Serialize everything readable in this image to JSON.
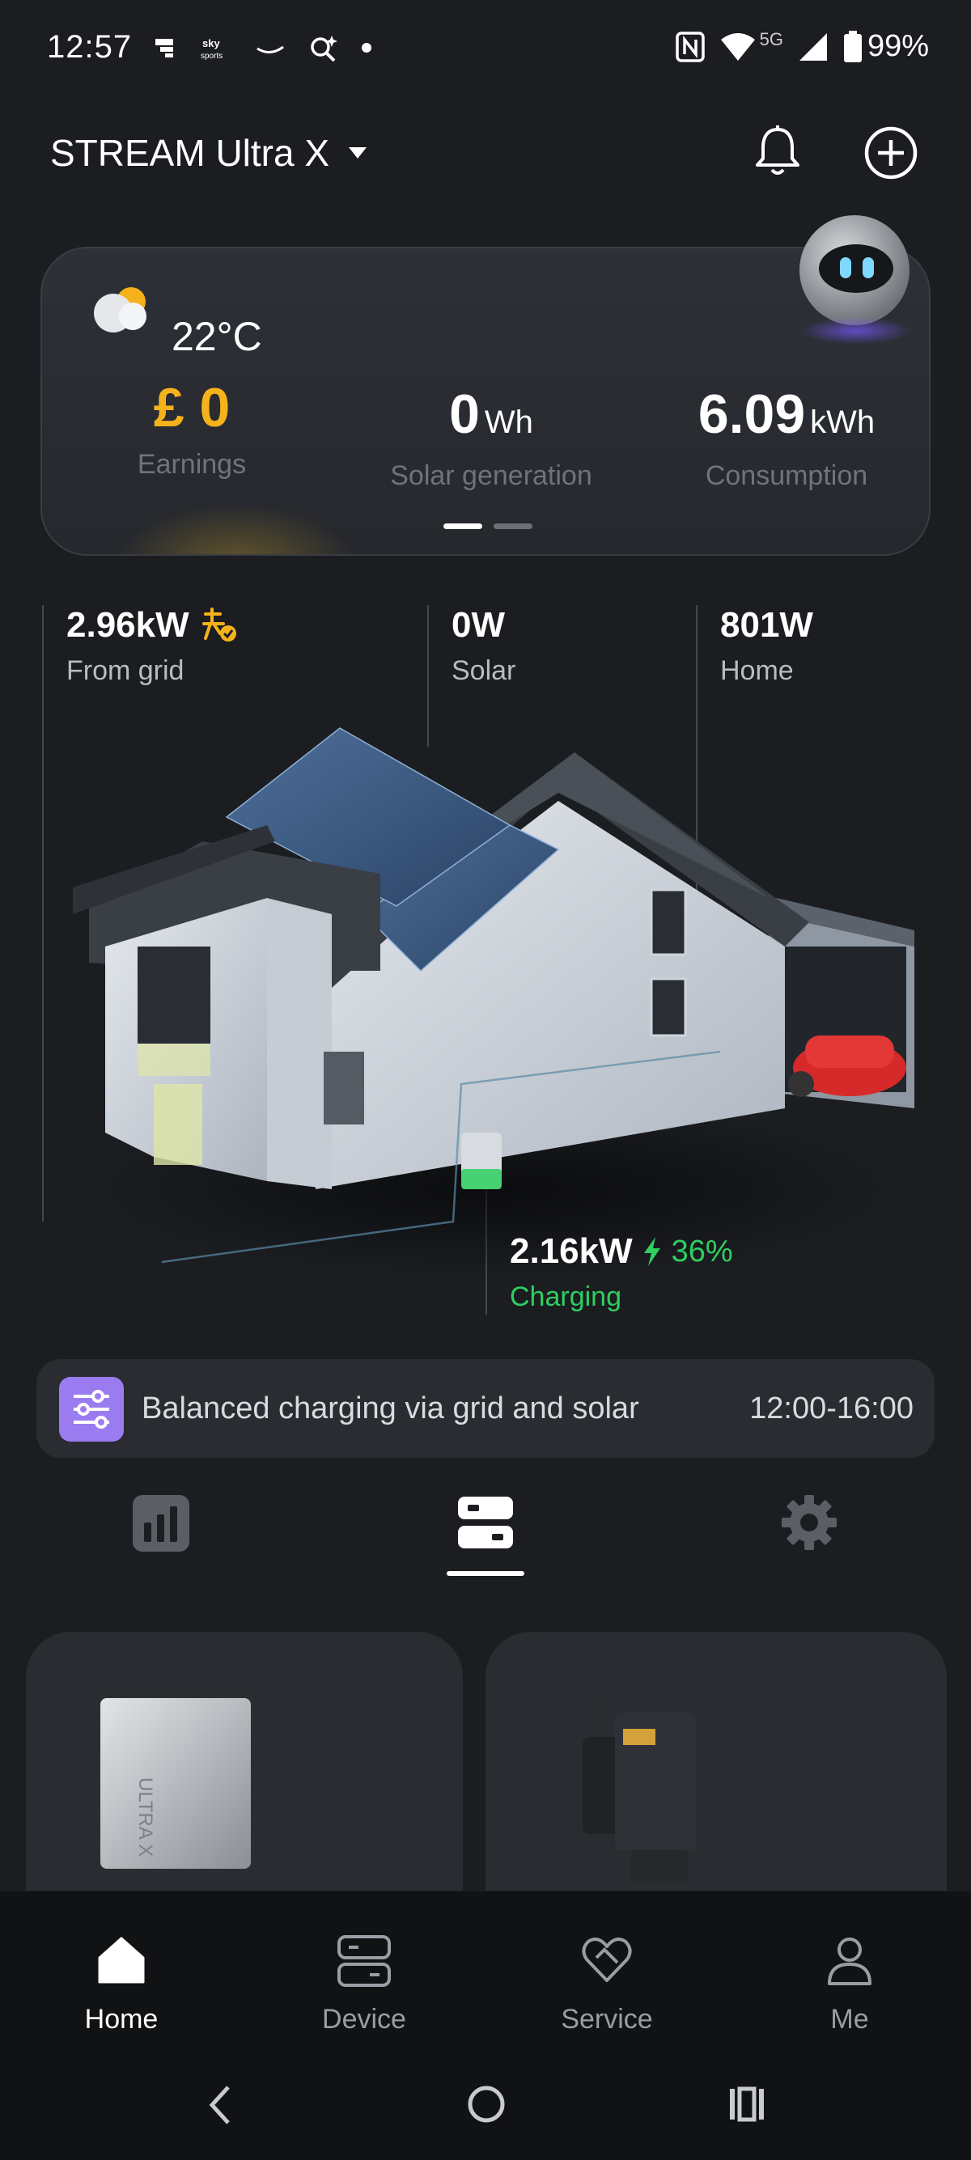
{
  "status_bar": {
    "time": "12:57",
    "network": "5G",
    "battery": "99%"
  },
  "header": {
    "device_name": "STREAM Ultra X",
    "bell_icon": "bell-icon",
    "add_icon": "plus-circle-icon"
  },
  "summary": {
    "temperature": "22°C",
    "earnings": {
      "value": "£ 0",
      "label": "Earnings"
    },
    "solar": {
      "value": "0",
      "unit": "Wh",
      "label": "Solar generation"
    },
    "consumption": {
      "value": "6.09",
      "unit": "kWh",
      "label": "Consumption"
    },
    "page_indicator": {
      "count": 2,
      "active": 0
    }
  },
  "flow": {
    "grid": {
      "value": "2.96kW",
      "label": "From grid"
    },
    "solar": {
      "value": "0W",
      "label": "Solar"
    },
    "home": {
      "value": "801W",
      "label": "Home"
    },
    "battery": {
      "value": "2.16kW",
      "percent": "36%",
      "label": "Charging"
    }
  },
  "mode": {
    "text": "Balanced charging via grid and solar",
    "time": "12:00-16:00"
  },
  "tabs": [
    {
      "icon": "bar-chart-icon",
      "active": false
    },
    {
      "icon": "device-icon",
      "active": true
    },
    {
      "icon": "gear-icon",
      "active": false
    }
  ],
  "device_cards": [
    {
      "device": "ULTRA X"
    },
    {
      "device": "smart-meter"
    }
  ],
  "bottom_nav": [
    {
      "label": "Home",
      "icon": "home-icon",
      "active": true
    },
    {
      "label": "Device",
      "icon": "device-icon",
      "active": false
    },
    {
      "label": "Service",
      "icon": "service-icon",
      "active": false
    },
    {
      "label": "Me",
      "icon": "person-icon",
      "active": false
    }
  ],
  "colors": {
    "background": "#1b1d21",
    "accent_gold": "#f5b21b",
    "charging_green": "#2fcf5f",
    "mode_purple": "#9b7cf0"
  }
}
